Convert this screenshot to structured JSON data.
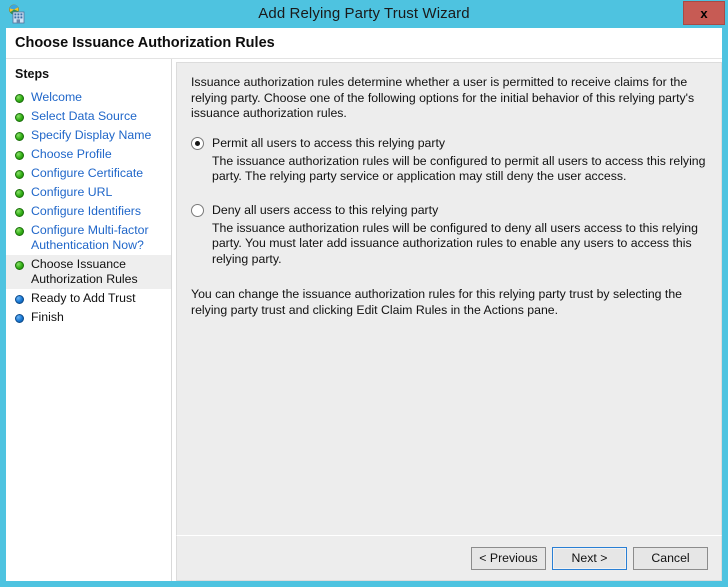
{
  "window": {
    "title": "Add Relying Party Trust Wizard",
    "app_icon": "adfs-relying-party-icon",
    "close_label": "x",
    "titlebar_color": "#4ec3e0",
    "close_color": "#c75b54"
  },
  "header": {
    "page_title": "Choose Issuance Authorization Rules"
  },
  "sidebar": {
    "title": "Steps",
    "items": [
      {
        "label": "Welcome",
        "state": "done"
      },
      {
        "label": "Select Data Source",
        "state": "done"
      },
      {
        "label": "Specify Display Name",
        "state": "done"
      },
      {
        "label": "Choose Profile",
        "state": "done"
      },
      {
        "label": "Configure Certificate",
        "state": "done"
      },
      {
        "label": "Configure URL",
        "state": "done"
      },
      {
        "label": "Configure Identifiers",
        "state": "done"
      },
      {
        "label": "Configure Multi-factor Authentication Now?",
        "state": "done"
      },
      {
        "label": "Choose Issuance Authorization Rules",
        "state": "current"
      },
      {
        "label": "Ready to Add Trust",
        "state": "pending"
      },
      {
        "label": "Finish",
        "state": "pending"
      }
    ],
    "done_color": "#33b016",
    "pending_color": "#1878d4",
    "link_color": "#1f66c9"
  },
  "main": {
    "intro": "Issuance authorization rules determine whether a user is permitted to receive claims for the relying party. Choose one of the following options for the initial behavior of this relying party's issuance authorization rules.",
    "options": [
      {
        "label": "Permit all users to access this relying party",
        "selected": true,
        "description": "The issuance authorization rules will be configured to permit all users to access this relying party. The relying party service or application may still deny the user access."
      },
      {
        "label": "Deny all users access to this relying party",
        "selected": false,
        "description": "The issuance authorization rules will be configured to deny all users access to this relying party. You must later add issuance authorization rules to enable any users to access this relying party."
      }
    ],
    "note": "You can change the issuance authorization rules for this relying party trust by selecting the relying party trust and clicking Edit Claim Rules in the Actions pane."
  },
  "footer": {
    "previous_label": "< Previous",
    "next_label": "Next >",
    "cancel_label": "Cancel",
    "focused_button": "Next >"
  }
}
